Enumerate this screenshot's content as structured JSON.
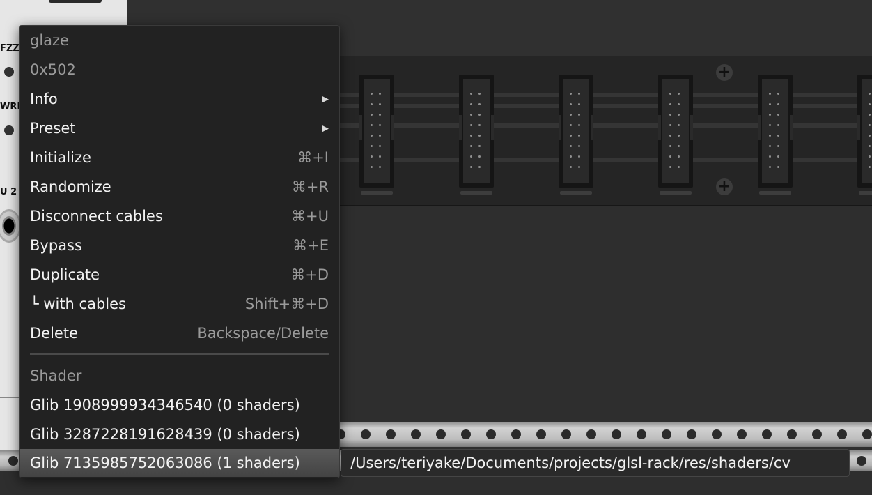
{
  "module_panel": {
    "labels": [
      "FZZ",
      "WRI",
      "U 2"
    ]
  },
  "menu": {
    "header_name": "glaze",
    "header_id": "0x502",
    "items": [
      {
        "label": "Info",
        "shortcut": "",
        "submenu": true
      },
      {
        "label": "Preset",
        "shortcut": "",
        "submenu": true
      },
      {
        "label": "Initialize",
        "shortcut": "⌘+I",
        "submenu": false
      },
      {
        "label": "Randomize",
        "shortcut": "⌘+R",
        "submenu": false
      },
      {
        "label": "Disconnect cables",
        "shortcut": "⌘+U",
        "submenu": false
      },
      {
        "label": "Bypass",
        "shortcut": "⌘+E",
        "submenu": false
      },
      {
        "label": "Duplicate",
        "shortcut": "⌘+D",
        "submenu": false
      },
      {
        "label": "└ with cables",
        "shortcut": "Shift+⌘+D",
        "submenu": false
      },
      {
        "label": "Delete",
        "shortcut": "Backspace/Delete",
        "submenu": false
      }
    ],
    "section_label": "Shader",
    "shader_items": [
      {
        "label": "Glib 1908999934346540 (0 shaders)"
      },
      {
        "label": "Glib 3287228191628439 (0 shaders)"
      },
      {
        "label": "Glib 7135985752063086 (1 shaders)",
        "hovered": true
      }
    ],
    "submenu_arrow": "▶"
  },
  "tooltip": {
    "text": "/Users/teriyake/Documents/projects/glsl-rack/res/shaders/cv"
  },
  "colors": {
    "menu_bg": "#222222",
    "hover_bg": "#4e4e4e",
    "text": "#f2f2f2",
    "dim_text": "#9a9a9a"
  }
}
